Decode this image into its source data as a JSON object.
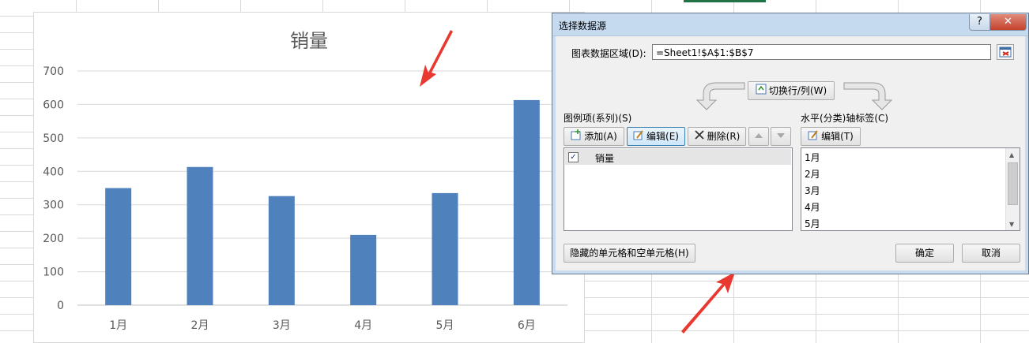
{
  "chart_data": {
    "type": "bar",
    "title": "销量",
    "categories": [
      "1月",
      "2月",
      "3月",
      "4月",
      "5月",
      "6月"
    ],
    "values": [
      350,
      413,
      326,
      210,
      335,
      613
    ],
    "ylim": [
      0,
      700
    ],
    "yticks": [
      "0",
      "100",
      "200",
      "300",
      "400",
      "500",
      "600",
      "700"
    ],
    "grid": true,
    "bar_color": "#4f81bd"
  },
  "dialog": {
    "title": "选择数据源",
    "help_label": "?",
    "close_label": "✕",
    "range_label": "图表数据区域(D):",
    "range_value": "=Sheet1!$A$1:$B$7",
    "switch_label": "切换行/列(W)",
    "legend_label": "图例项(系列)(S)",
    "axis_label": "水平(分类)轴标签(C)",
    "add_label": "添加(A)",
    "edit_label": "编辑(E)",
    "delete_label": "删除(R)",
    "axis_edit_label": "编辑(T)",
    "series": [
      {
        "name": "销量",
        "checked": "✓"
      }
    ],
    "categories": [
      "1月",
      "2月",
      "3月",
      "4月",
      "5月"
    ],
    "hidden_cells_label": "隐藏的单元格和空单元格(H)",
    "ok_label": "确定",
    "cancel_label": "取消"
  },
  "colors": {
    "arrow": "#e8382f",
    "accent_grid": "#217346"
  }
}
